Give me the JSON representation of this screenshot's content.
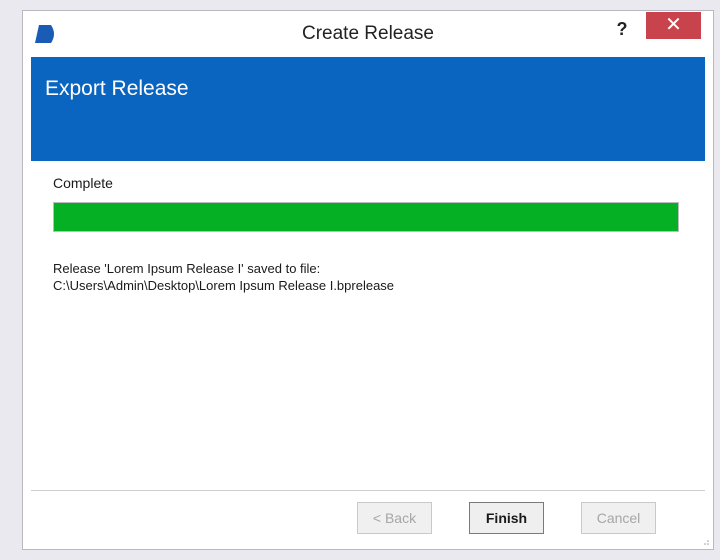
{
  "window": {
    "title": "Create Release",
    "help_label": "?",
    "close_label": "✕"
  },
  "header": {
    "title": "Export Release"
  },
  "status": {
    "label": "Complete",
    "progress_fraction": 1.0,
    "progress_color": "#06b025"
  },
  "message": {
    "line1": "Release 'Lorem Ipsum Release I' saved to file:",
    "line2": "C:\\Users\\Admin\\Desktop\\Lorem Ipsum Release I.bprelease"
  },
  "buttons": {
    "back": "< Back",
    "finish": "Finish",
    "cancel": "Cancel"
  },
  "colors": {
    "banner": "#0a65c1",
    "close_button": "#c8434b",
    "logo": "#1a5bb5"
  },
  "icons": {
    "logo": "app-logo-icon",
    "resize": "resize-grip-icon"
  }
}
